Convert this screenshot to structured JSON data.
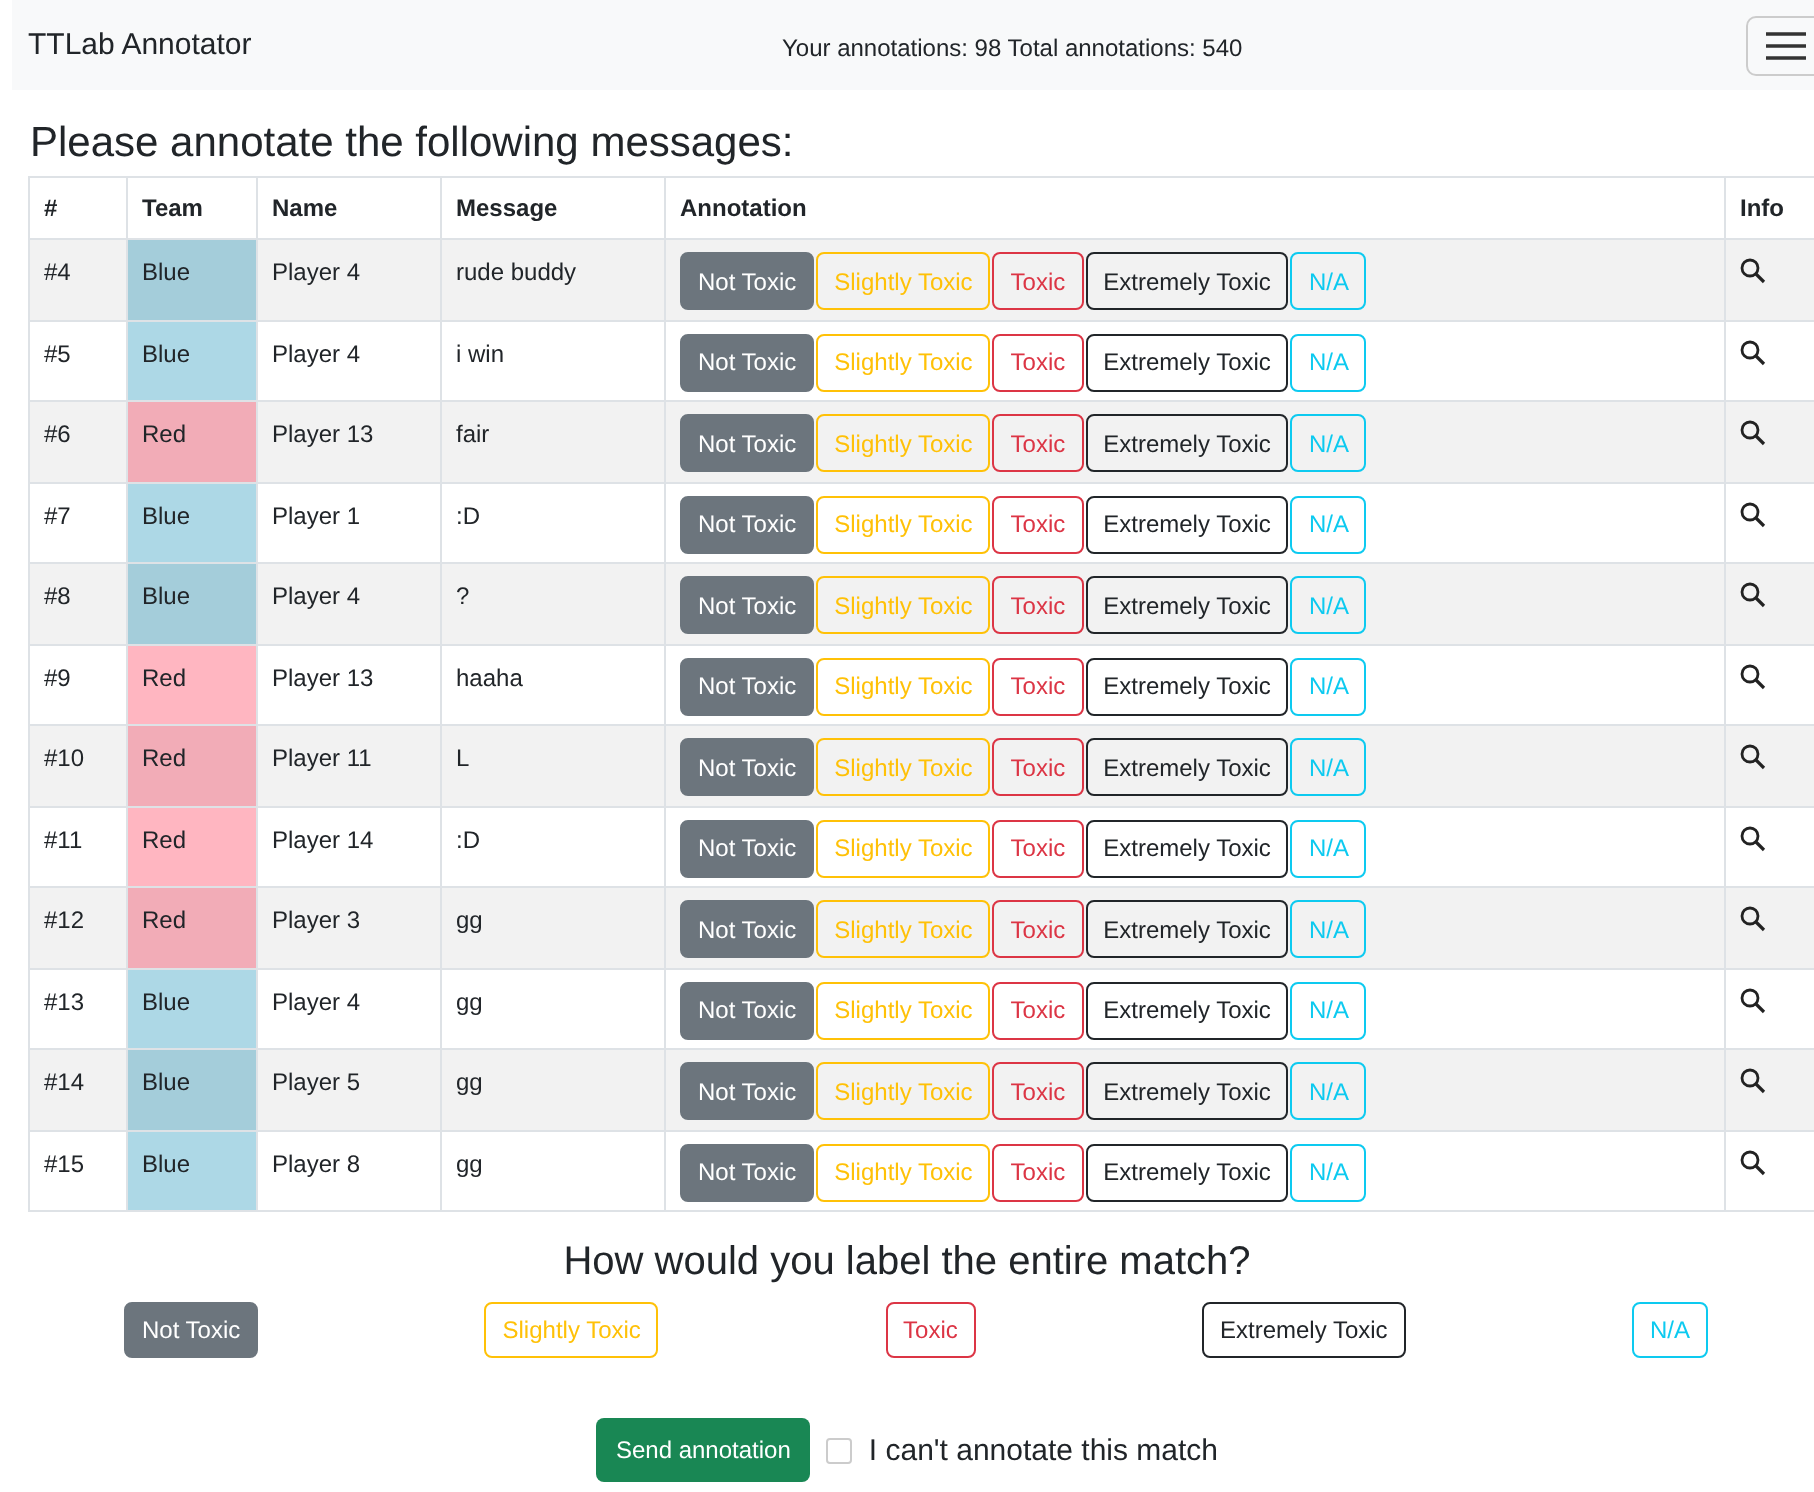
{
  "navbar": {
    "brand": "TTLab Annotator",
    "stats": "Your annotations: 98 Total annotations: 540"
  },
  "heading": "Please annotate the following messages:",
  "table": {
    "columns": [
      "#",
      "Team",
      "Name",
      "Message",
      "Annotation",
      "Info"
    ],
    "rows": [
      {
        "id": "#4",
        "team": "Blue",
        "color": "#add8e6",
        "name": "Player 4",
        "message": "rude buddy",
        "options": [
          {
            "label": "Not Toxic",
            "kind": "secondary",
            "selected": true
          },
          {
            "label": "Slightly Toxic",
            "kind": "warning",
            "selected": false
          },
          {
            "label": "Toxic",
            "kind": "danger",
            "selected": false
          },
          {
            "label": "Extremely Toxic",
            "kind": "dark",
            "selected": false
          },
          {
            "label": "N/A",
            "kind": "info",
            "selected": false
          }
        ]
      },
      {
        "id": "#5",
        "team": "Blue",
        "color": "#add8e6",
        "name": "Player 4",
        "message": "i win",
        "options": [
          {
            "label": "Not Toxic",
            "kind": "secondary",
            "selected": true
          },
          {
            "label": "Slightly Toxic",
            "kind": "warning",
            "selected": false
          },
          {
            "label": "Toxic",
            "kind": "danger",
            "selected": false
          },
          {
            "label": "Extremely Toxic",
            "kind": "dark",
            "selected": false
          },
          {
            "label": "N/A",
            "kind": "info",
            "selected": false
          }
        ]
      },
      {
        "id": "#6",
        "team": "Red",
        "color": "#ffb6c1",
        "name": "Player 13",
        "message": "fair",
        "options": [
          {
            "label": "Not Toxic",
            "kind": "secondary",
            "selected": true
          },
          {
            "label": "Slightly Toxic",
            "kind": "warning",
            "selected": false
          },
          {
            "label": "Toxic",
            "kind": "danger",
            "selected": false
          },
          {
            "label": "Extremely Toxic",
            "kind": "dark",
            "selected": false
          },
          {
            "label": "N/A",
            "kind": "info",
            "selected": false
          }
        ]
      },
      {
        "id": "#7",
        "team": "Blue",
        "color": "#add8e6",
        "name": "Player 1",
        "message": ":D",
        "options": [
          {
            "label": "Not Toxic",
            "kind": "secondary",
            "selected": true
          },
          {
            "label": "Slightly Toxic",
            "kind": "warning",
            "selected": false
          },
          {
            "label": "Toxic",
            "kind": "danger",
            "selected": false
          },
          {
            "label": "Extremely Toxic",
            "kind": "dark",
            "selected": false
          },
          {
            "label": "N/A",
            "kind": "info",
            "selected": false
          }
        ]
      },
      {
        "id": "#8",
        "team": "Blue",
        "color": "#add8e6",
        "name": "Player 4",
        "message": "?",
        "options": [
          {
            "label": "Not Toxic",
            "kind": "secondary",
            "selected": true
          },
          {
            "label": "Slightly Toxic",
            "kind": "warning",
            "selected": false
          },
          {
            "label": "Toxic",
            "kind": "danger",
            "selected": false
          },
          {
            "label": "Extremely Toxic",
            "kind": "dark",
            "selected": false
          },
          {
            "label": "N/A",
            "kind": "info",
            "selected": false
          }
        ]
      },
      {
        "id": "#9",
        "team": "Red",
        "color": "#ffb6c1",
        "name": "Player 13",
        "message": "haaha",
        "options": [
          {
            "label": "Not Toxic",
            "kind": "secondary",
            "selected": true
          },
          {
            "label": "Slightly Toxic",
            "kind": "warning",
            "selected": false
          },
          {
            "label": "Toxic",
            "kind": "danger",
            "selected": false
          },
          {
            "label": "Extremely Toxic",
            "kind": "dark",
            "selected": false
          },
          {
            "label": "N/A",
            "kind": "info",
            "selected": false
          }
        ]
      },
      {
        "id": "#10",
        "team": "Red",
        "color": "#ffb6c1",
        "name": "Player 11",
        "message": "L",
        "options": [
          {
            "label": "Not Toxic",
            "kind": "secondary",
            "selected": true
          },
          {
            "label": "Slightly Toxic",
            "kind": "warning",
            "selected": false
          },
          {
            "label": "Toxic",
            "kind": "danger",
            "selected": false
          },
          {
            "label": "Extremely Toxic",
            "kind": "dark",
            "selected": false
          },
          {
            "label": "N/A",
            "kind": "info",
            "selected": false
          }
        ]
      },
      {
        "id": "#11",
        "team": "Red",
        "color": "#ffb6c1",
        "name": "Player 14",
        "message": ":D",
        "options": [
          {
            "label": "Not Toxic",
            "kind": "secondary",
            "selected": true
          },
          {
            "label": "Slightly Toxic",
            "kind": "warning",
            "selected": false
          },
          {
            "label": "Toxic",
            "kind": "danger",
            "selected": false
          },
          {
            "label": "Extremely Toxic",
            "kind": "dark",
            "selected": false
          },
          {
            "label": "N/A",
            "kind": "info",
            "selected": false
          }
        ]
      },
      {
        "id": "#12",
        "team": "Red",
        "color": "#ffb6c1",
        "name": "Player 3",
        "message": "gg",
        "options": [
          {
            "label": "Not Toxic",
            "kind": "secondary",
            "selected": true
          },
          {
            "label": "Slightly Toxic",
            "kind": "warning",
            "selected": false
          },
          {
            "label": "Toxic",
            "kind": "danger",
            "selected": false
          },
          {
            "label": "Extremely Toxic",
            "kind": "dark",
            "selected": false
          },
          {
            "label": "N/A",
            "kind": "info",
            "selected": false
          }
        ]
      },
      {
        "id": "#13",
        "team": "Blue",
        "color": "#add8e6",
        "name": "Player 4",
        "message": "gg",
        "options": [
          {
            "label": "Not Toxic",
            "kind": "secondary",
            "selected": true
          },
          {
            "label": "Slightly Toxic",
            "kind": "warning",
            "selected": false
          },
          {
            "label": "Toxic",
            "kind": "danger",
            "selected": false
          },
          {
            "label": "Extremely Toxic",
            "kind": "dark",
            "selected": false
          },
          {
            "label": "N/A",
            "kind": "info",
            "selected": false
          }
        ]
      },
      {
        "id": "#14",
        "team": "Blue",
        "color": "#add8e6",
        "name": "Player 5",
        "message": "gg",
        "options": [
          {
            "label": "Not Toxic",
            "kind": "secondary",
            "selected": true
          },
          {
            "label": "Slightly Toxic",
            "kind": "warning",
            "selected": false
          },
          {
            "label": "Toxic",
            "kind": "danger",
            "selected": false
          },
          {
            "label": "Extremely Toxic",
            "kind": "dark",
            "selected": false
          },
          {
            "label": "N/A",
            "kind": "info",
            "selected": false
          }
        ]
      },
      {
        "id": "#15",
        "team": "Blue",
        "color": "#add8e6",
        "name": "Player 8",
        "message": "gg",
        "options": [
          {
            "label": "Not Toxic",
            "kind": "secondary",
            "selected": true
          },
          {
            "label": "Slightly Toxic",
            "kind": "warning",
            "selected": false
          },
          {
            "label": "Toxic",
            "kind": "danger",
            "selected": false
          },
          {
            "label": "Extremely Toxic",
            "kind": "dark",
            "selected": false
          },
          {
            "label": "N/A",
            "kind": "info",
            "selected": false
          }
        ]
      }
    ]
  },
  "match": {
    "question": "How would you label the entire match?",
    "options": [
      {
        "label": "Not Toxic",
        "kind": "secondary",
        "selected": true
      },
      {
        "label": "Slightly Toxic",
        "kind": "warning",
        "selected": false
      },
      {
        "label": "Toxic",
        "kind": "danger",
        "selected": false
      },
      {
        "label": "Extremely Toxic",
        "kind": "dark",
        "selected": false
      },
      {
        "label": "N/A",
        "kind": "info",
        "selected": false
      }
    ]
  },
  "submit": {
    "button": "Send annotation",
    "cant_annotate": {
      "label": "I can't annotate this match",
      "checked": false
    }
  }
}
